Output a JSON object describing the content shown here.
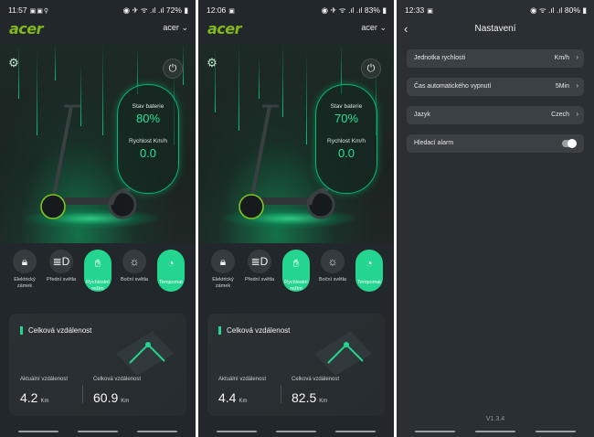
{
  "colors": {
    "accent": "#23d58e",
    "brand": "#83b81a",
    "bg": "#22272b"
  },
  "screens": [
    {
      "status": {
        "time": "11:57",
        "right": "72%"
      },
      "logo": "acer",
      "account": "acer",
      "battery_label": "Stav baterie",
      "battery_value": "80%",
      "speed_label": "Rychlost Km/h",
      "speed_value": "0.0",
      "controls": [
        {
          "label": "Elektrický zámek",
          "icon": "lock-icon",
          "active": false
        },
        {
          "label": "Přední světla",
          "icon": "headlight-icon",
          "active": false
        },
        {
          "label": "Rychlostní režim",
          "icon": "hand-icon",
          "active": true
        },
        {
          "label": "Boční světla",
          "icon": "sun-icon",
          "active": false
        },
        {
          "label": "Tempomat",
          "icon": "gauge-icon",
          "active": true
        }
      ],
      "distance": {
        "title": "Celková vzdálenost",
        "current_label": "Aktuální vzdálenost",
        "current_value": "4.2",
        "total_label": "Celková vzdálenost",
        "total_value": "60.9",
        "unit": "Km"
      }
    },
    {
      "status": {
        "time": "12:06",
        "right": "83%"
      },
      "logo": "acer",
      "account": "acer",
      "battery_label": "Stav baterie",
      "battery_value": "70%",
      "speed_label": "Rychlost Km/h",
      "speed_value": "0.0",
      "controls": [
        {
          "label": "Elektrický zámek",
          "icon": "lock-icon",
          "active": false
        },
        {
          "label": "Přední světla",
          "icon": "headlight-icon",
          "active": false
        },
        {
          "label": "Rychlostní režim",
          "icon": "hand-icon",
          "active": true
        },
        {
          "label": "Boční světla",
          "icon": "sun-icon",
          "active": false
        },
        {
          "label": "Tempomat",
          "icon": "gauge-icon",
          "active": true
        }
      ],
      "distance": {
        "title": "Celková vzdálenost",
        "current_label": "Aktuální vzdálenost",
        "current_value": "4.4",
        "total_label": "Celková vzdálenost",
        "total_value": "82.5",
        "unit": "Km"
      }
    }
  ],
  "settings": {
    "status": {
      "time": "12:33",
      "right": "80%"
    },
    "title": "Nastavení",
    "rows": [
      {
        "label": "Jednotka rychlosti",
        "value": "Km/h"
      },
      {
        "label": "Čas automatického vypnutí",
        "value": "5Min"
      },
      {
        "label": "Jazyk",
        "value": "Czech"
      }
    ],
    "toggle_row": {
      "label": "Hledací alarm",
      "on": false
    },
    "version": "V1.3.4"
  }
}
